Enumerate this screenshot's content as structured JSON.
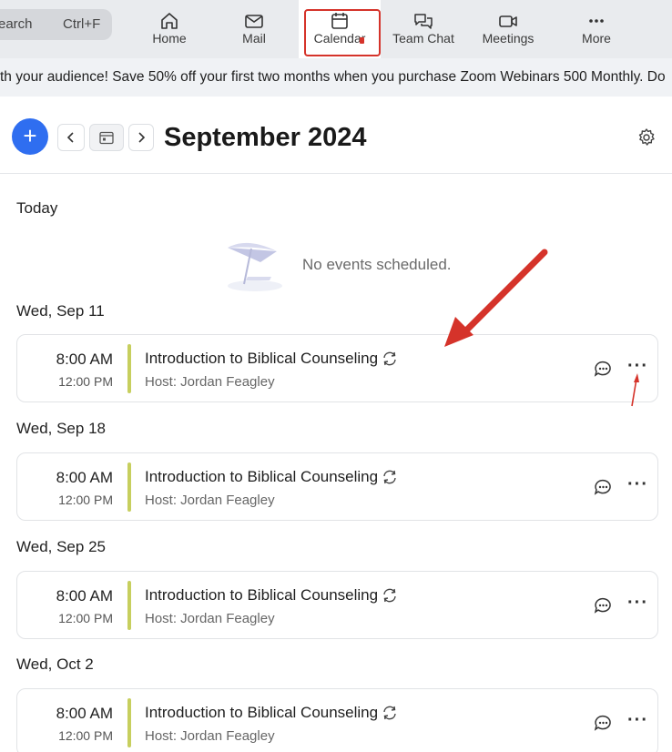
{
  "topbar": {
    "search_label": "earch",
    "search_shortcut": "Ctrl+F",
    "nav": [
      {
        "label": "Home",
        "icon": "home-icon"
      },
      {
        "label": "Mail",
        "icon": "mail-icon"
      },
      {
        "label": "Calendar",
        "icon": "calendar-icon",
        "active": true
      },
      {
        "label": "Team Chat",
        "icon": "team-chat-icon"
      },
      {
        "label": "Meetings",
        "icon": "video-icon"
      },
      {
        "label": "More",
        "icon": "more-icon"
      }
    ]
  },
  "promo": {
    "text": "th your audience! Save 50% off your first two months when you purchase Zoom Webinars 500 Monthly. Do"
  },
  "header": {
    "add_label": "+",
    "month": "September 2024"
  },
  "today": {
    "label": "Today",
    "empty_message": "No events scheduled."
  },
  "events": [
    {
      "date": "Wed, Sep 11",
      "start": "8:00 AM",
      "end": "12:00 PM",
      "title": "Introduction to Biblical Counseling",
      "host": "Host: Jordan Feagley"
    },
    {
      "date": "Wed, Sep 18",
      "start": "8:00 AM",
      "end": "12:00 PM",
      "title": "Introduction to Biblical Counseling",
      "host": "Host: Jordan Feagley"
    },
    {
      "date": "Wed, Sep 25",
      "start": "8:00 AM",
      "end": "12:00 PM",
      "title": "Introduction to Biblical Counseling",
      "host": "Host: Jordan Feagley"
    },
    {
      "date": "Wed, Oct 2",
      "start": "8:00 AM",
      "end": "12:00 PM",
      "title": "Introduction to Biblical Counseling",
      "host": "Host: Jordan Feagley"
    }
  ],
  "more_label": "···",
  "colors": {
    "accent": "#2f6ef0",
    "event_bar": "#c7cf5e",
    "annotation": "#d5332a"
  }
}
